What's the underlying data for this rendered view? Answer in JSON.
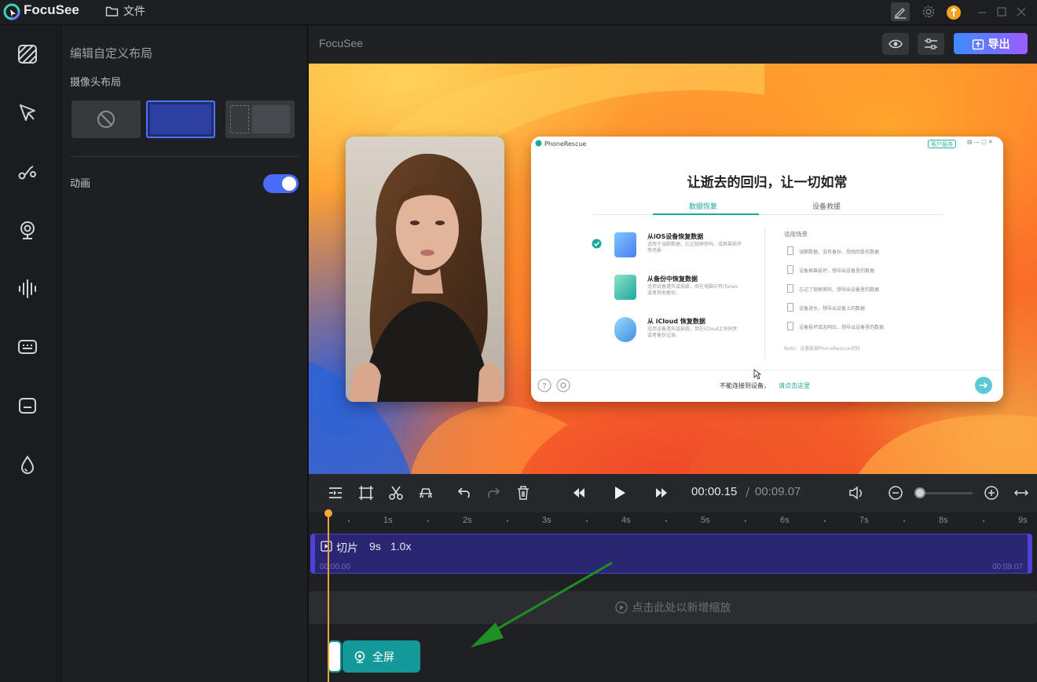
{
  "titlebar": {
    "app_name": "FocuSee",
    "file_menu": "文件",
    "icons": [
      "logo-icon",
      "folder-icon",
      "edit-icon",
      "gear-icon",
      "upgrade-icon",
      "minimize-icon",
      "maximize-icon",
      "close-icon"
    ]
  },
  "rail": {
    "icons": [
      "background-icon",
      "cursor-icon",
      "path-icon",
      "webcam-icon",
      "audio-icon",
      "captions-icon",
      "subtitle-icon",
      "watermark-icon"
    ]
  },
  "panel": {
    "title": "编辑自定义布局",
    "camera_layout_label": "摄像头布局",
    "layout_options": [
      "none",
      "full",
      "side"
    ],
    "selected_layout": "full",
    "animation_label": "动画",
    "animation_enabled": true,
    "accent": "#4a6cf7"
  },
  "preview": {
    "title": "FocuSee",
    "export_label": "导出"
  },
  "phonerescue": {
    "app_name": "PhoneRescue",
    "service": "客户服务",
    "headline": "让逝去的回归，让一切如常",
    "tab_active": "数据恢复",
    "tab_inactive": "设备救援",
    "options": [
      {
        "title": "从iOS设备恢复数据",
        "desc": "适用于误删数据、忘记锁屏密码、或屏幕损坏等场景"
      },
      {
        "title": "从备份中恢复数据",
        "desc": "适用设备遗失或损毁，但在电脑中有iTunes或者其他备份。"
      },
      {
        "title": "从 iCloud 恢复数据",
        "desc": "适用设备遗失或损毁，但在iCloud上有同步或者备份记录。"
      }
    ],
    "scenarios_title": "适用场景",
    "scenarios": [
      "误删数据，没有备份，想找回丢失数据",
      "设备屏幕损坏，想导出设备里的数据",
      "忘记了锁屏密码，想导出设备里的数据",
      "设备进水，想导出设备上的数据",
      "设备损坏或无响应，想导出设备里的数据"
    ],
    "note": "Note：设备能被PhoneRescue识别",
    "cant_connect": "不能连接到设备，",
    "click_here": "请点击这里"
  },
  "controls": {
    "time_current": "00:00.15",
    "time_separator": "/",
    "time_total": "00:09.07",
    "zoom_level": 0.0
  },
  "timeline": {
    "ticks": [
      "1s",
      "2s",
      "3s",
      "4s",
      "5s",
      "6s",
      "7s",
      "8s",
      "9s"
    ],
    "clip": {
      "label": "切片",
      "duration": "9s",
      "speed": "1.0x",
      "start": "00:00.00",
      "end": "00:09.07"
    },
    "add_zoom": "点击此处以新增缩放",
    "camera_block": "全屏",
    "playhead_time": "00:00.15"
  }
}
